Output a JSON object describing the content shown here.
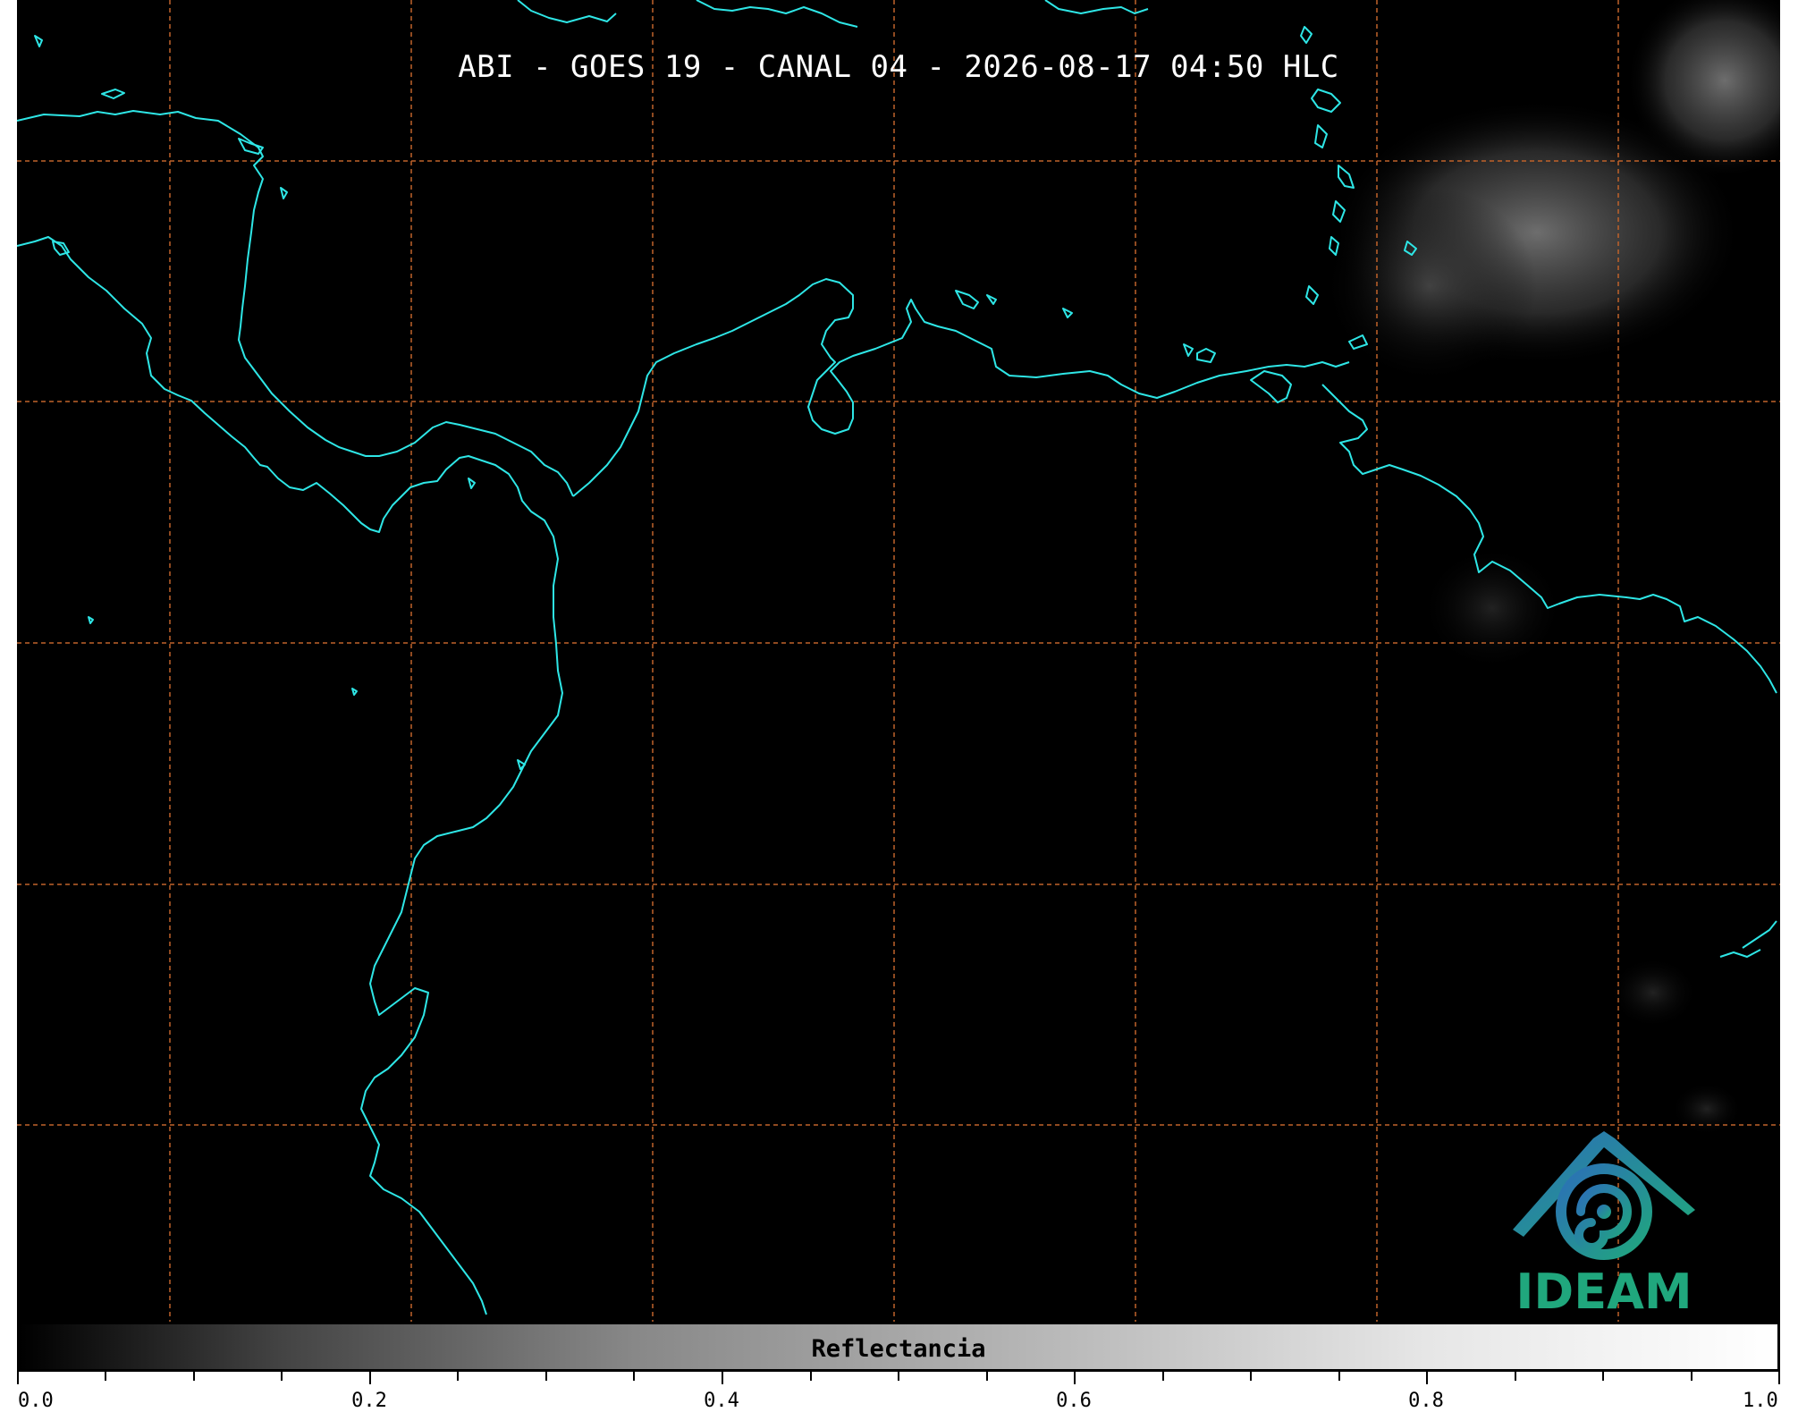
{
  "map": {
    "title": "ABI - GOES 19 - CANAL 04 - 2026-08-17 04:50 HLC",
    "background": "#000000",
    "coastline_color": "#2ee6e6",
    "grid_color": "#c0622a"
  },
  "logo": {
    "text": "IDEAM",
    "icon": "ideam-logo-icon"
  },
  "colorbar": {
    "label": "Reflectancia",
    "colormap": "grayscale",
    "range": [
      0.0,
      1.0
    ],
    "tick_labels": [
      "0.0",
      "0.2",
      "0.4",
      "0.6",
      "0.8",
      "1.0"
    ]
  }
}
